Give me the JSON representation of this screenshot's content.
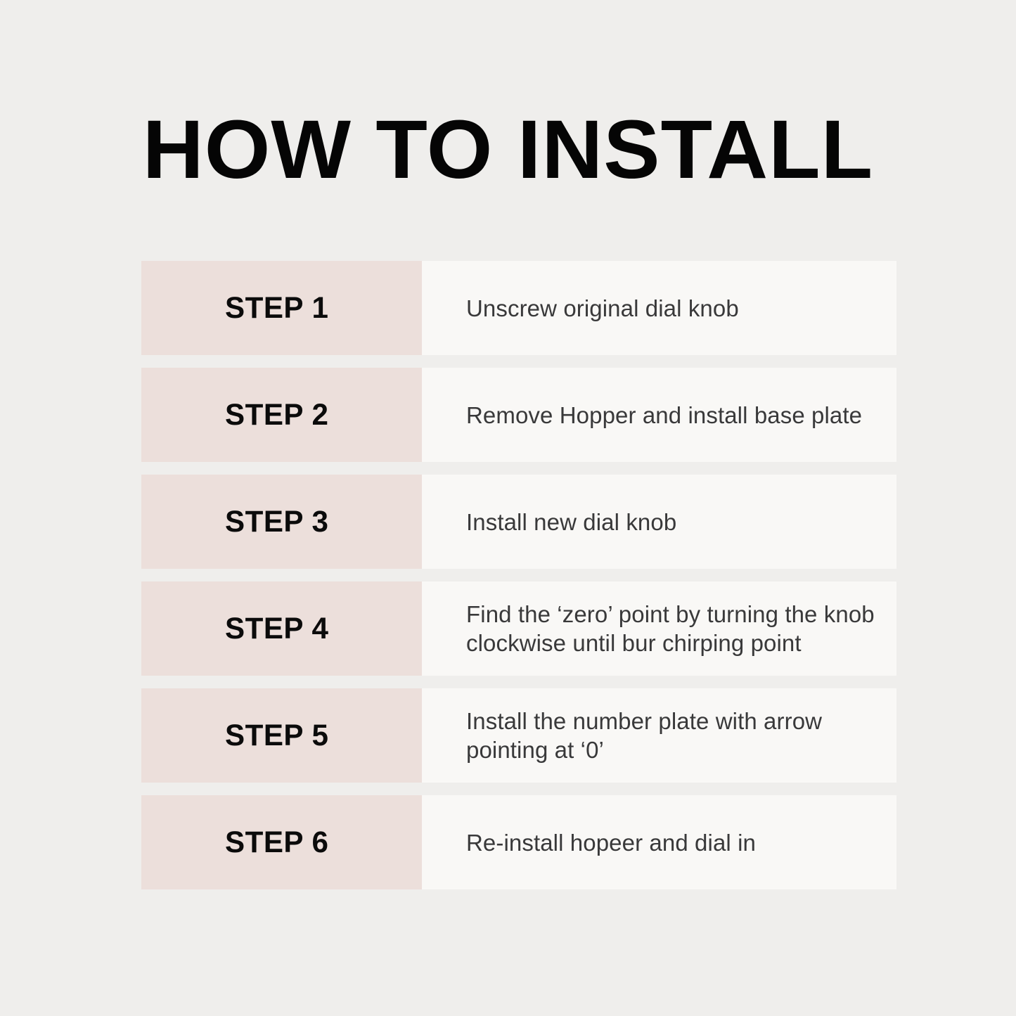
{
  "page": {
    "title": "HOW TO INSTALL",
    "background_color": "#efeeec",
    "label_block_color": "#ecdfdb",
    "description_block_color": "#f9f8f6",
    "title_color": "#050505",
    "label_text_color": "#0b0b0b",
    "description_text_color": "#39393a"
  },
  "steps": [
    {
      "label": "STEP 1",
      "description": "Unscrew original dial knob"
    },
    {
      "label": "STEP 2",
      "description": "Remove Hopper and install base plate"
    },
    {
      "label": "STEP 3",
      "description": "Install new dial knob"
    },
    {
      "label": "STEP 4",
      "description": "Find the ‘zero’ point by turning the knob clockwise until bur chirping point"
    },
    {
      "label": "STEP 5",
      "description": "Install the number plate with arrow pointing at ‘0’"
    },
    {
      "label": "STEP 6",
      "description": "Re-install hopeer and dial in"
    }
  ]
}
